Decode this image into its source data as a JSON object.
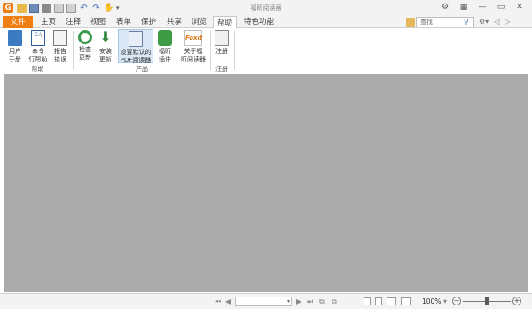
{
  "window": {
    "title": "福昕阅读器",
    "app_icon": "G"
  },
  "quick_access": {
    "icons": [
      "open-folder-icon",
      "save-icon",
      "print-icon",
      "document-icon",
      "undo-icon",
      "redo-icon",
      "hand-tool-icon",
      "dropdown-icon"
    ]
  },
  "menu": {
    "tabs": [
      "文件",
      "主页",
      "注释",
      "视图",
      "表单",
      "保护",
      "共享",
      "浏览",
      "帮助",
      "特色功能"
    ],
    "active_tab": "帮助",
    "search_placeholder": "查找"
  },
  "ribbon": {
    "groups": [
      {
        "label": "帮助",
        "buttons": [
          {
            "line1": "用户",
            "line2": "手册"
          },
          {
            "line1": "命令",
            "line2": "行帮助"
          },
          {
            "line1": "报告",
            "line2": "错误"
          }
        ]
      },
      {
        "label": "产品",
        "buttons": [
          {
            "line1": "检查",
            "line2": "更新"
          },
          {
            "line1": "安装",
            "line2": "更新"
          },
          {
            "line1": "设置默认的",
            "line2": "PDF阅读器"
          },
          {
            "line1": "福昕",
            "line2": "插件"
          },
          {
            "line1": "关于福",
            "line2": "昕阅读器"
          }
        ]
      },
      {
        "label": "注册",
        "buttons": [
          {
            "line1": "注册",
            "line2": ""
          }
        ]
      }
    ]
  },
  "about_icon_text": "Foxit",
  "cmd_icon_text": "C:\\",
  "statusbar": {
    "zoom": "100%",
    "zoom_level": 0.5
  },
  "colors": {
    "accent": "#f07f13",
    "document_background": "#ababab"
  }
}
